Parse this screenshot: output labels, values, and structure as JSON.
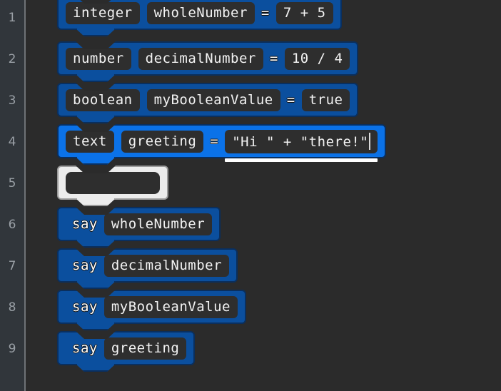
{
  "app": {
    "kind": "block-code-editor",
    "background_color": "#2b2b2b",
    "gutter_color": "#31363b",
    "block_color": "#0b4f9e",
    "block_active_color": "#0b72e8",
    "block_ghost_color": "#ececec",
    "field_color": "#2e2e2e",
    "text_color": "#f2f2f2"
  },
  "gutter": {
    "line_numbers": [
      "1",
      "2",
      "3",
      "4",
      "5",
      "6",
      "7",
      "8",
      "9"
    ]
  },
  "rows": [
    {
      "line": "1",
      "type": "declaration",
      "state": "normal",
      "tokens": [
        {
          "kind": "pill",
          "text": "integer"
        },
        {
          "kind": "pill",
          "text": "wholeNumber"
        },
        {
          "kind": "plain",
          "text": "="
        },
        {
          "kind": "pill",
          "text": "7 + 5"
        }
      ]
    },
    {
      "line": "2",
      "type": "declaration",
      "state": "normal",
      "tokens": [
        {
          "kind": "pill",
          "text": "number"
        },
        {
          "kind": "pill",
          "text": "decimalNumber"
        },
        {
          "kind": "plain",
          "text": "="
        },
        {
          "kind": "pill",
          "text": "10 / 4"
        }
      ]
    },
    {
      "line": "3",
      "type": "declaration",
      "state": "normal",
      "tokens": [
        {
          "kind": "pill",
          "text": "boolean"
        },
        {
          "kind": "pill",
          "text": "myBooleanValue"
        },
        {
          "kind": "plain",
          "text": "="
        },
        {
          "kind": "pill",
          "text": "true"
        }
      ]
    },
    {
      "line": "4",
      "type": "declaration",
      "state": "active",
      "tokens": [
        {
          "kind": "pill",
          "text": "text"
        },
        {
          "kind": "pill",
          "text": "greeting"
        },
        {
          "kind": "plain",
          "text": "="
        },
        {
          "kind": "pill",
          "text": "\"Hi \" + \"there!\"",
          "focused": true,
          "caret": true
        }
      ]
    },
    {
      "line": "5",
      "type": "empty-placeholder",
      "state": "ghost",
      "tokens": [
        {
          "kind": "pill-empty",
          "text": ""
        }
      ]
    },
    {
      "line": "6",
      "type": "statement",
      "state": "normal",
      "tokens": [
        {
          "kind": "plain",
          "text": "say"
        },
        {
          "kind": "pill",
          "text": "wholeNumber"
        }
      ]
    },
    {
      "line": "7",
      "type": "statement",
      "state": "normal",
      "tokens": [
        {
          "kind": "plain",
          "text": "say"
        },
        {
          "kind": "pill",
          "text": "decimalNumber"
        }
      ]
    },
    {
      "line": "8",
      "type": "statement",
      "state": "normal",
      "tokens": [
        {
          "kind": "plain",
          "text": "say"
        },
        {
          "kind": "pill",
          "text": "myBooleanValue"
        }
      ]
    },
    {
      "line": "9",
      "type": "statement",
      "state": "normal",
      "tokens": [
        {
          "kind": "plain",
          "text": "say"
        },
        {
          "kind": "pill",
          "text": "greeting"
        }
      ]
    }
  ]
}
